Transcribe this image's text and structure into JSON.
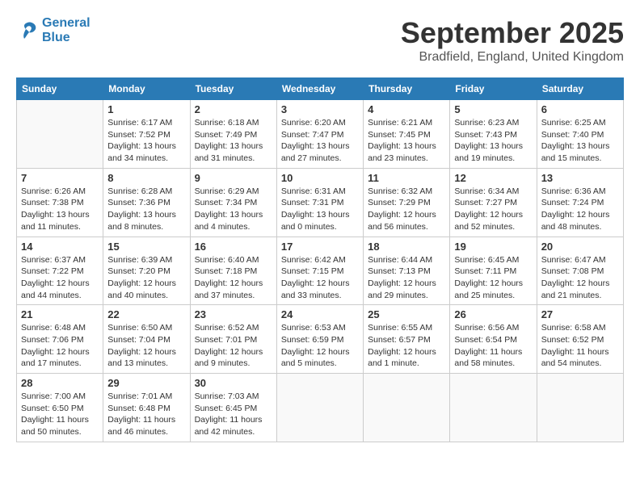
{
  "header": {
    "logo_line1": "General",
    "logo_line2": "Blue",
    "month_title": "September 2025",
    "location": "Bradfield, England, United Kingdom"
  },
  "days_of_week": [
    "Sunday",
    "Monday",
    "Tuesday",
    "Wednesday",
    "Thursday",
    "Friday",
    "Saturday"
  ],
  "weeks": [
    [
      {
        "day": "",
        "sunrise": "",
        "sunset": "",
        "daylight": ""
      },
      {
        "day": "1",
        "sunrise": "Sunrise: 6:17 AM",
        "sunset": "Sunset: 7:52 PM",
        "daylight": "Daylight: 13 hours and 34 minutes."
      },
      {
        "day": "2",
        "sunrise": "Sunrise: 6:18 AM",
        "sunset": "Sunset: 7:49 PM",
        "daylight": "Daylight: 13 hours and 31 minutes."
      },
      {
        "day": "3",
        "sunrise": "Sunrise: 6:20 AM",
        "sunset": "Sunset: 7:47 PM",
        "daylight": "Daylight: 13 hours and 27 minutes."
      },
      {
        "day": "4",
        "sunrise": "Sunrise: 6:21 AM",
        "sunset": "Sunset: 7:45 PM",
        "daylight": "Daylight: 13 hours and 23 minutes."
      },
      {
        "day": "5",
        "sunrise": "Sunrise: 6:23 AM",
        "sunset": "Sunset: 7:43 PM",
        "daylight": "Daylight: 13 hours and 19 minutes."
      },
      {
        "day": "6",
        "sunrise": "Sunrise: 6:25 AM",
        "sunset": "Sunset: 7:40 PM",
        "daylight": "Daylight: 13 hours and 15 minutes."
      }
    ],
    [
      {
        "day": "7",
        "sunrise": "Sunrise: 6:26 AM",
        "sunset": "Sunset: 7:38 PM",
        "daylight": "Daylight: 13 hours and 11 minutes."
      },
      {
        "day": "8",
        "sunrise": "Sunrise: 6:28 AM",
        "sunset": "Sunset: 7:36 PM",
        "daylight": "Daylight: 13 hours and 8 minutes."
      },
      {
        "day": "9",
        "sunrise": "Sunrise: 6:29 AM",
        "sunset": "Sunset: 7:34 PM",
        "daylight": "Daylight: 13 hours and 4 minutes."
      },
      {
        "day": "10",
        "sunrise": "Sunrise: 6:31 AM",
        "sunset": "Sunset: 7:31 PM",
        "daylight": "Daylight: 13 hours and 0 minutes."
      },
      {
        "day": "11",
        "sunrise": "Sunrise: 6:32 AM",
        "sunset": "Sunset: 7:29 PM",
        "daylight": "Daylight: 12 hours and 56 minutes."
      },
      {
        "day": "12",
        "sunrise": "Sunrise: 6:34 AM",
        "sunset": "Sunset: 7:27 PM",
        "daylight": "Daylight: 12 hours and 52 minutes."
      },
      {
        "day": "13",
        "sunrise": "Sunrise: 6:36 AM",
        "sunset": "Sunset: 7:24 PM",
        "daylight": "Daylight: 12 hours and 48 minutes."
      }
    ],
    [
      {
        "day": "14",
        "sunrise": "Sunrise: 6:37 AM",
        "sunset": "Sunset: 7:22 PM",
        "daylight": "Daylight: 12 hours and 44 minutes."
      },
      {
        "day": "15",
        "sunrise": "Sunrise: 6:39 AM",
        "sunset": "Sunset: 7:20 PM",
        "daylight": "Daylight: 12 hours and 40 minutes."
      },
      {
        "day": "16",
        "sunrise": "Sunrise: 6:40 AM",
        "sunset": "Sunset: 7:18 PM",
        "daylight": "Daylight: 12 hours and 37 minutes."
      },
      {
        "day": "17",
        "sunrise": "Sunrise: 6:42 AM",
        "sunset": "Sunset: 7:15 PM",
        "daylight": "Daylight: 12 hours and 33 minutes."
      },
      {
        "day": "18",
        "sunrise": "Sunrise: 6:44 AM",
        "sunset": "Sunset: 7:13 PM",
        "daylight": "Daylight: 12 hours and 29 minutes."
      },
      {
        "day": "19",
        "sunrise": "Sunrise: 6:45 AM",
        "sunset": "Sunset: 7:11 PM",
        "daylight": "Daylight: 12 hours and 25 minutes."
      },
      {
        "day": "20",
        "sunrise": "Sunrise: 6:47 AM",
        "sunset": "Sunset: 7:08 PM",
        "daylight": "Daylight: 12 hours and 21 minutes."
      }
    ],
    [
      {
        "day": "21",
        "sunrise": "Sunrise: 6:48 AM",
        "sunset": "Sunset: 7:06 PM",
        "daylight": "Daylight: 12 hours and 17 minutes."
      },
      {
        "day": "22",
        "sunrise": "Sunrise: 6:50 AM",
        "sunset": "Sunset: 7:04 PM",
        "daylight": "Daylight: 12 hours and 13 minutes."
      },
      {
        "day": "23",
        "sunrise": "Sunrise: 6:52 AM",
        "sunset": "Sunset: 7:01 PM",
        "daylight": "Daylight: 12 hours and 9 minutes."
      },
      {
        "day": "24",
        "sunrise": "Sunrise: 6:53 AM",
        "sunset": "Sunset: 6:59 PM",
        "daylight": "Daylight: 12 hours and 5 minutes."
      },
      {
        "day": "25",
        "sunrise": "Sunrise: 6:55 AM",
        "sunset": "Sunset: 6:57 PM",
        "daylight": "Daylight: 12 hours and 1 minute."
      },
      {
        "day": "26",
        "sunrise": "Sunrise: 6:56 AM",
        "sunset": "Sunset: 6:54 PM",
        "daylight": "Daylight: 11 hours and 58 minutes."
      },
      {
        "day": "27",
        "sunrise": "Sunrise: 6:58 AM",
        "sunset": "Sunset: 6:52 PM",
        "daylight": "Daylight: 11 hours and 54 minutes."
      }
    ],
    [
      {
        "day": "28",
        "sunrise": "Sunrise: 7:00 AM",
        "sunset": "Sunset: 6:50 PM",
        "daylight": "Daylight: 11 hours and 50 minutes."
      },
      {
        "day": "29",
        "sunrise": "Sunrise: 7:01 AM",
        "sunset": "Sunset: 6:48 PM",
        "daylight": "Daylight: 11 hours and 46 minutes."
      },
      {
        "day": "30",
        "sunrise": "Sunrise: 7:03 AM",
        "sunset": "Sunset: 6:45 PM",
        "daylight": "Daylight: 11 hours and 42 minutes."
      },
      {
        "day": "",
        "sunrise": "",
        "sunset": "",
        "daylight": ""
      },
      {
        "day": "",
        "sunrise": "",
        "sunset": "",
        "daylight": ""
      },
      {
        "day": "",
        "sunrise": "",
        "sunset": "",
        "daylight": ""
      },
      {
        "day": "",
        "sunrise": "",
        "sunset": "",
        "daylight": ""
      }
    ]
  ]
}
